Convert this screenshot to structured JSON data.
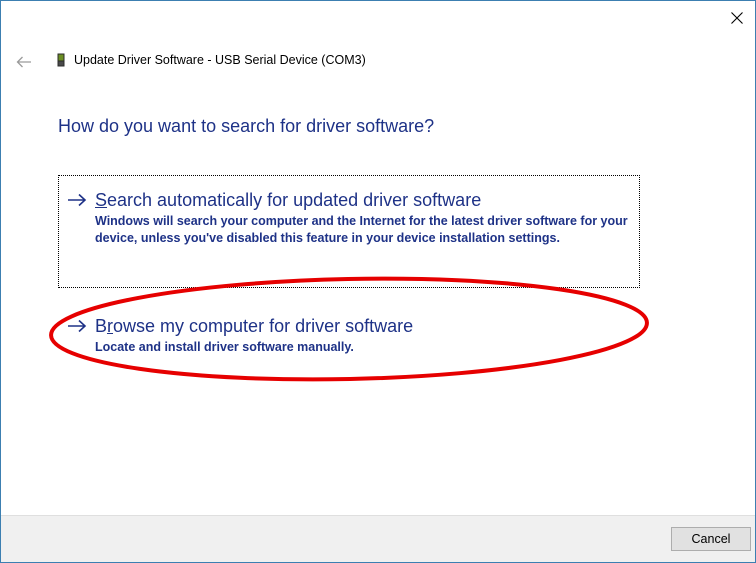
{
  "window": {
    "title": "Update Driver Software - USB Serial Device (COM3)",
    "close_icon": "close-icon",
    "back_icon": "back-arrow-icon",
    "device_icon": "usb-device-icon"
  },
  "main": {
    "heading": "How do you want to search for driver software?",
    "options": [
      {
        "icon": "arrow-right-icon",
        "mnemonic": "S",
        "title_rest": "earch automatically for updated driver software",
        "description": "Windows will search your computer and the Internet for the latest driver software for your device, unless you've disabled this feature in your device installation settings."
      },
      {
        "icon": "arrow-right-icon",
        "title_first": "B",
        "mnemonic": "r",
        "title_rest": "owse my computer for driver software",
        "description": "Locate and install driver software manually."
      }
    ]
  },
  "footer": {
    "cancel_label": "Cancel"
  },
  "colors": {
    "link_text": "#1e3287",
    "annotation_ellipse": "#e60000",
    "window_border": "#3c7fb1",
    "footer_bg": "#f0f0f0"
  }
}
